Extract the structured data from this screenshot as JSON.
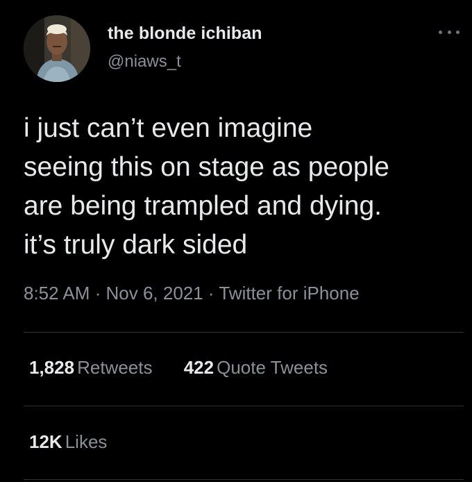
{
  "tweet": {
    "author": {
      "display_name": "the blonde ichiban",
      "handle": "@niaws_t"
    },
    "text_lines": [
      "i just can’t even imagine",
      "seeing this on stage as people",
      "are being trampled and dying.",
      "it’s truly dark sided"
    ],
    "meta": "8:52 AM · Nov 6, 2021 · Twitter for iPhone",
    "stats": {
      "retweets": {
        "count": "1,828",
        "label": "Retweets"
      },
      "quote_tweets": {
        "count": "422",
        "label": "Quote Tweets"
      },
      "likes": {
        "count": "12K",
        "label": "Likes"
      }
    }
  },
  "icons": {
    "more": "more-horizontal-icon"
  },
  "colors": {
    "background": "#000000",
    "primary_text": "#e7e9ea",
    "secondary_text": "#8b9198",
    "divider": "#2f3336"
  }
}
